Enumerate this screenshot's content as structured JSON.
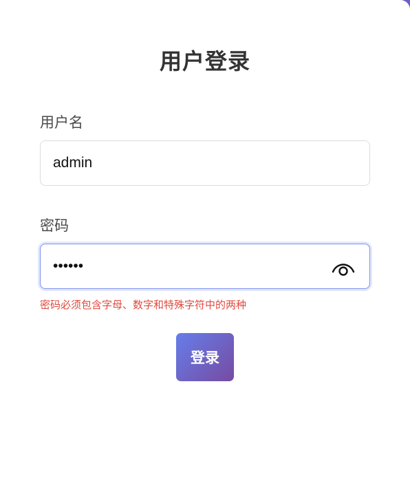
{
  "form": {
    "title": "用户登录",
    "username_label": "用户名",
    "username_value": "admin",
    "password_label": "密码",
    "password_value": "123456",
    "password_error": "密码必须包含字母、数字和特殊字符中的两种",
    "submit_label": "登录"
  },
  "icons": {
    "toggle_visibility": "eye-icon"
  },
  "colors": {
    "error": "#e04a3f",
    "button_gradient_start": "#667eea",
    "button_gradient_end": "#764ba2",
    "focus_border": "#7b8ff0"
  }
}
